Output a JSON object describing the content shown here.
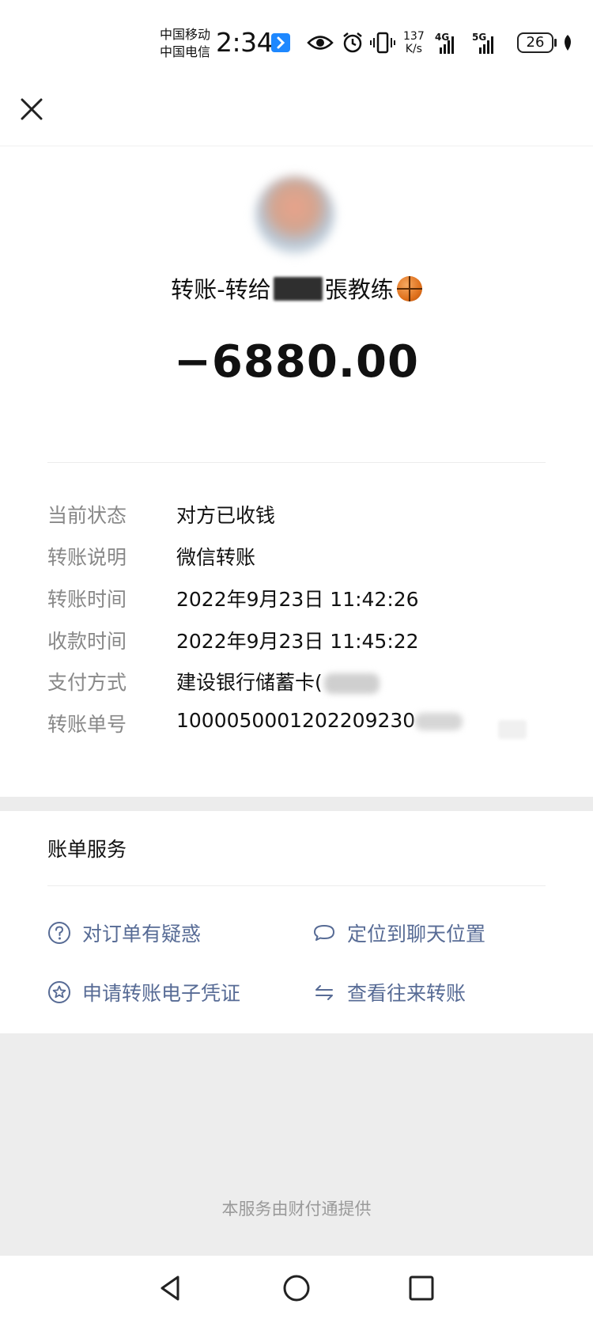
{
  "status_bar": {
    "carrier_1": "中国移动",
    "carrier_2": "中国电信",
    "time": "2:34",
    "net_speed_value": "137",
    "net_speed_unit": "K/s",
    "network_1": "4G",
    "network_2": "5G",
    "battery": "26"
  },
  "header": {
    "close_icon": "close-icon"
  },
  "transfer": {
    "title_prefix": "转账-转给",
    "title_suffix": "張教练",
    "amount": "−6880.00"
  },
  "details": [
    {
      "label": "当前状态",
      "value": "对方已收钱"
    },
    {
      "label": "转账说明",
      "value": "微信转账"
    },
    {
      "label": "转账时间",
      "value": "2022年9月23日 11:42:26"
    },
    {
      "label": "收款时间",
      "value": "2022年9月23日 11:45:22"
    },
    {
      "label": "支付方式",
      "value": "建设银行储蓄卡("
    },
    {
      "label": "转账单号",
      "value": "1000050001202209230"
    }
  ],
  "services": {
    "title": "账单服务",
    "items": [
      {
        "label": "对订单有疑惑",
        "icon": "question-circle-icon"
      },
      {
        "label": "定位到聊天位置",
        "icon": "chat-bubble-icon"
      },
      {
        "label": "申请转账电子凭证",
        "icon": "star-circle-icon"
      },
      {
        "label": "查看往来转账",
        "icon": "exchange-arrows-icon"
      }
    ]
  },
  "footer": {
    "text": "本服务由财付通提供"
  },
  "colors": {
    "link": "#576b95",
    "label_gray": "#888888",
    "footer_bg": "#ededed"
  }
}
